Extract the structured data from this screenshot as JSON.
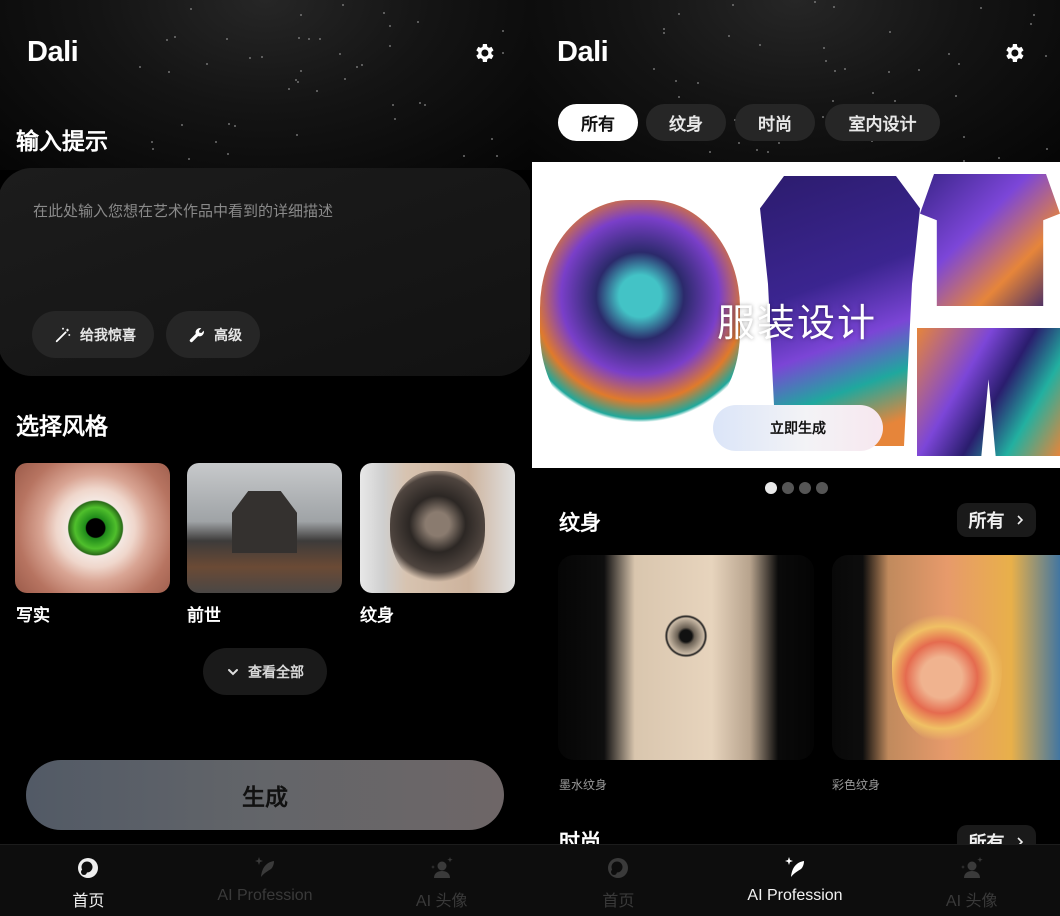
{
  "app": {
    "title": "Dali",
    "settings_icon": "gear-icon"
  },
  "home": {
    "prompt": {
      "section_title": "输入提示",
      "placeholder": "在此处输入您想在艺术作品中看到的详细描述",
      "value": "",
      "surprise_label": "给我惊喜",
      "surprise_icon": "magic-wand-icon",
      "advanced_label": "高级",
      "advanced_icon": "wrench-icon"
    },
    "styles": {
      "section_title": "选择风格",
      "items": [
        {
          "label": "写实",
          "image": "green-eye-closeup"
        },
        {
          "label": "前世",
          "image": "foggy-haunted-house"
        },
        {
          "label": "纹身",
          "image": "lion-tattoo-arm"
        }
      ],
      "view_all_label": "查看全部",
      "view_all_icon": "chevron-down-icon"
    },
    "generate_label": "生成",
    "generate_gradient": [
      "#525a66",
      "#6e6667"
    ]
  },
  "profession": {
    "tabs": [
      {
        "label": "所有",
        "active": true
      },
      {
        "label": "纹身",
        "active": false
      },
      {
        "label": "时尚",
        "active": false
      },
      {
        "label": "室内设计",
        "active": false
      }
    ],
    "banner": {
      "title": "服装设计",
      "button_label": "立即生成",
      "image": "tropical-ape-apparel",
      "slide_count": 4,
      "active_slide": 1
    },
    "categories": [
      {
        "title": "纹身",
        "see_all_label": "所有",
        "items": [
          {
            "label": "墨水纹身",
            "image": "ink-eye-tattoo"
          },
          {
            "label": "彩色纹身",
            "image": "color-face-tattoo"
          }
        ]
      },
      {
        "title": "时尚",
        "see_all_label": "所有"
      }
    ]
  },
  "nav": {
    "items": [
      {
        "label": "首页",
        "icon": "dali-logo-icon"
      },
      {
        "label": "AI Profession",
        "icon": "sparkle-feather-icon"
      },
      {
        "label": "AI 头像",
        "icon": "avatar-sparkle-icon"
      }
    ],
    "home_screen_active": 0,
    "profession_screen_active": 1
  },
  "colors": {
    "background": "#000000",
    "card": "#1a1a1a",
    "chip": "#262626",
    "nav_bg": "#0d0d0d",
    "nav_inactive": "#3a3a3a",
    "text_primary": "#ffffff",
    "text_muted": "#8a8a8a"
  }
}
